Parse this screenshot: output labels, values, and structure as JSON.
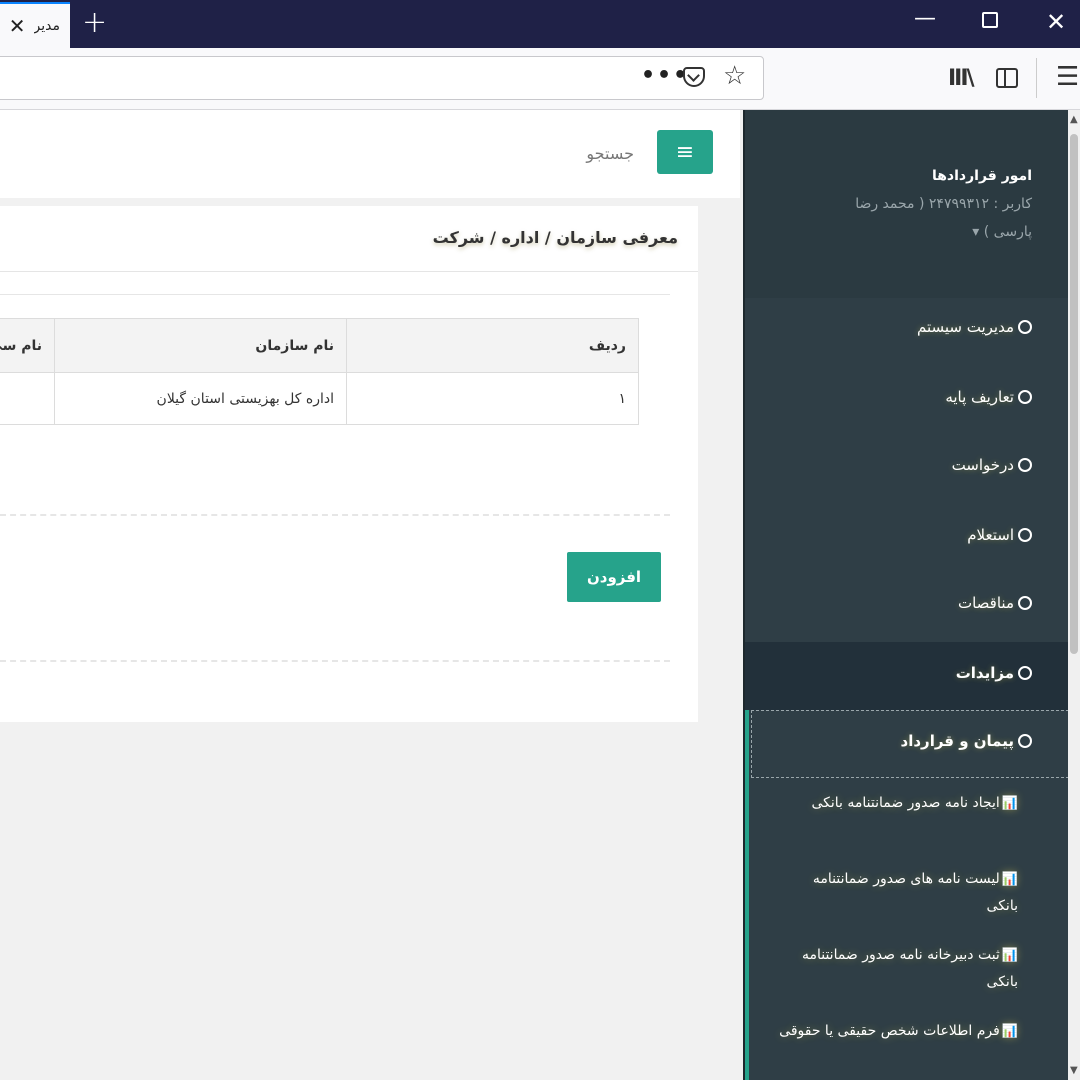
{
  "browser": {
    "tab_title": "مدیر",
    "tab_close": "✕",
    "new_tab": "+",
    "min": "—",
    "close": "✕",
    "url_dots": "•••",
    "star": "☆",
    "library": "III\\",
    "menu": "☰"
  },
  "topbar": {
    "menu_icon": "≡",
    "search_label": "جستجو"
  },
  "card": {
    "breadcrumb": "معرفی سازمان / اداره / شرکت",
    "table": {
      "headers": [
        "ردیف",
        "نام سازمان",
        "نام سی"
      ],
      "rows": [
        [
          "۱",
          "اداره کل بهزیستی استان گیلان",
          ""
        ]
      ]
    },
    "add_button": "افزودن"
  },
  "sidebar": {
    "app_title": "امور قراردادها",
    "user": "کاربر : ۲۴۷۹۹۳۱۲ ( محمد رضا",
    "lang": "پارسی ) ▾",
    "menu": [
      {
        "label": "مدیریت سیستم"
      },
      {
        "label": "تعاریف پایه"
      },
      {
        "label": "درخواست"
      },
      {
        "label": "استعلام"
      },
      {
        "label": "مناقصات"
      },
      {
        "label": "مزایدات"
      },
      {
        "label": "پیمان و قرارداد"
      }
    ],
    "submenu": [
      {
        "label": "ایجاد نامه صدور ضمانتنامه بانکی"
      },
      {
        "label": "لیست نامه های صدور ضمانتنامه بانکی"
      },
      {
        "label": "ثبت دبیرخانه نامه صدور ضمانتنامه بانکی"
      },
      {
        "label": "فرم اطلاعات شخص حقیقی یا حقوقی"
      }
    ],
    "sub_icon": "📊"
  }
}
